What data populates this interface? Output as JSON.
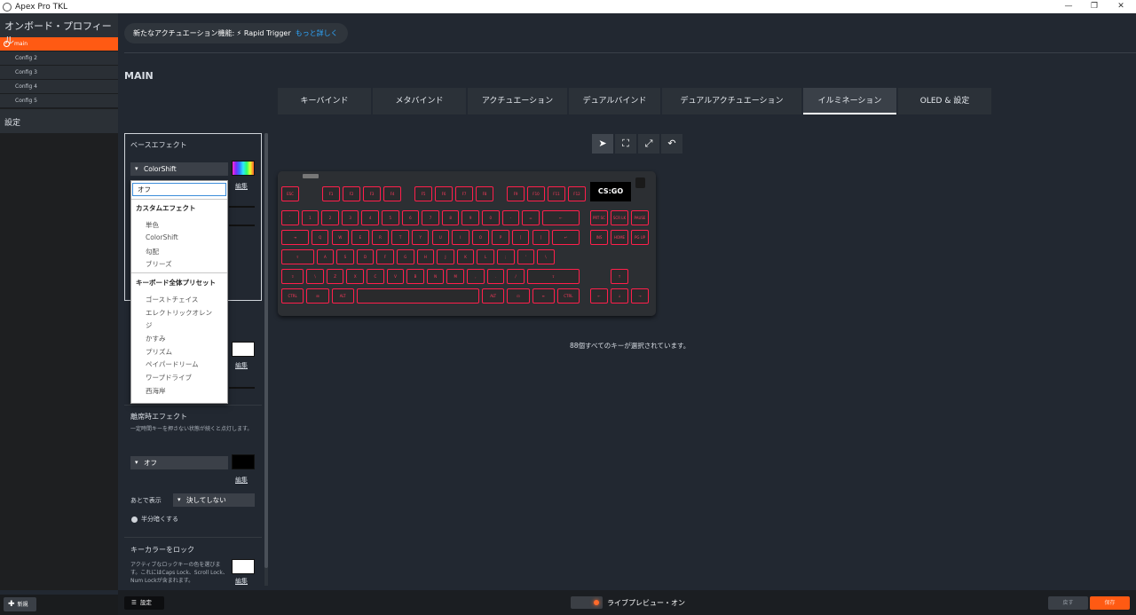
{
  "window": {
    "title": "Apex Pro TKL",
    "minimize": "—",
    "maximize": "❐",
    "close": "✕"
  },
  "sidebar": {
    "header": "オンボード・プロフィール",
    "profiles": [
      {
        "label": "main",
        "active": true
      },
      {
        "label": "Config 2"
      },
      {
        "label": "Config 3"
      },
      {
        "label": "Config 4"
      },
      {
        "label": "Config 5"
      }
    ],
    "settings": "設定",
    "new_button": "新規"
  },
  "banner": {
    "text": "新たなアクチュエーション機能: ⚡ Rapid Trigger",
    "more": "もっと詳しく"
  },
  "main_title": "MAIN",
  "tabs": [
    "キーバインド",
    "メタバインド",
    "アクチュエーション",
    "デュアルバインド",
    "デュアルアクチュエーション",
    "イルミネーション",
    "OLED & 設定"
  ],
  "active_tab": "イルミネーション",
  "panel": {
    "base_effect": {
      "title": "ベースエフェクト",
      "selected": "ColorShift",
      "edit": "編集"
    },
    "second_edit": "編集",
    "idle": {
      "title": "離席時エフェクト",
      "desc": "一定時間キーを押さない状態が続くと点灯します。",
      "selected": "オフ",
      "edit": "編集",
      "after_label": "あとで表示",
      "after_value": "決してしない",
      "half_dim": "半分暗くする"
    },
    "lock": {
      "title": "キーカラーをロック",
      "desc": "アクティブなロックキーの色を選びます。これにはCaps Lock、Scroll Lock、Num Lockが含まれます。",
      "edit": "編集"
    }
  },
  "dropdown_menu": {
    "off": "オフ",
    "custom_header": "カスタムエフェクト",
    "custom": [
      "単色",
      "ColorShift",
      "勾配",
      "ブリーズ"
    ],
    "preset_header": "キーボード全体プリセット",
    "presets": [
      "ゴーストチェイス",
      "エレクトリックオレン",
      "ジ",
      "かすみ",
      "プリズム",
      "ペイパードリーム",
      "ワープドライブ",
      "西海岸"
    ]
  },
  "toolbar_icons": [
    "pointer-icon",
    "select-box-icon",
    "expand-icon",
    "undo-icon"
  ],
  "keyboard": {
    "oled_text": "CS:GO",
    "row_fn": [
      "ESC",
      "F1",
      "F2",
      "F3",
      "F4",
      "F5",
      "F6",
      "F7",
      "F8",
      "F9",
      "F10",
      "F11",
      "F12"
    ],
    "row_num": [
      "`",
      "1",
      "2",
      "3",
      "4",
      "5",
      "6",
      "7",
      "8",
      "9",
      "0",
      "-",
      "=",
      "←"
    ],
    "row_q": [
      "⇥",
      "Q",
      "W",
      "E",
      "R",
      "T",
      "Y",
      "U",
      "I",
      "O",
      "P",
      "[",
      "]",
      "↵"
    ],
    "row_a": [
      "⇪",
      "A",
      "S",
      "D",
      "F",
      "G",
      "H",
      "J",
      "K",
      "L",
      ";",
      "'",
      "\\"
    ],
    "row_z": [
      "⇧",
      "\\",
      "Z",
      "X",
      "C",
      "V",
      "B",
      "N",
      "M",
      ",",
      ".",
      "/",
      "⇧"
    ],
    "row_ctrl": [
      "CTRL",
      "⊞",
      "ALT",
      "",
      "",
      "",
      "ALT",
      "⊡",
      "≡",
      "CTRL"
    ],
    "nav1": [
      "PRT SC",
      "SCR LK",
      "PAUSE"
    ],
    "nav2": [
      "INS",
      "HOME",
      "PG UP"
    ],
    "nav3": [
      "DEL",
      "END",
      "PG DN"
    ],
    "arrows": [
      "↑",
      "←",
      "↓",
      "→"
    ],
    "accent": "#ff1f4b"
  },
  "status_text": "88個すべてのキーが選択されています。",
  "bottom": {
    "settings": "設定",
    "live_preview": "ライブプレビュー・オン",
    "back": "戻す",
    "save": "保存"
  }
}
